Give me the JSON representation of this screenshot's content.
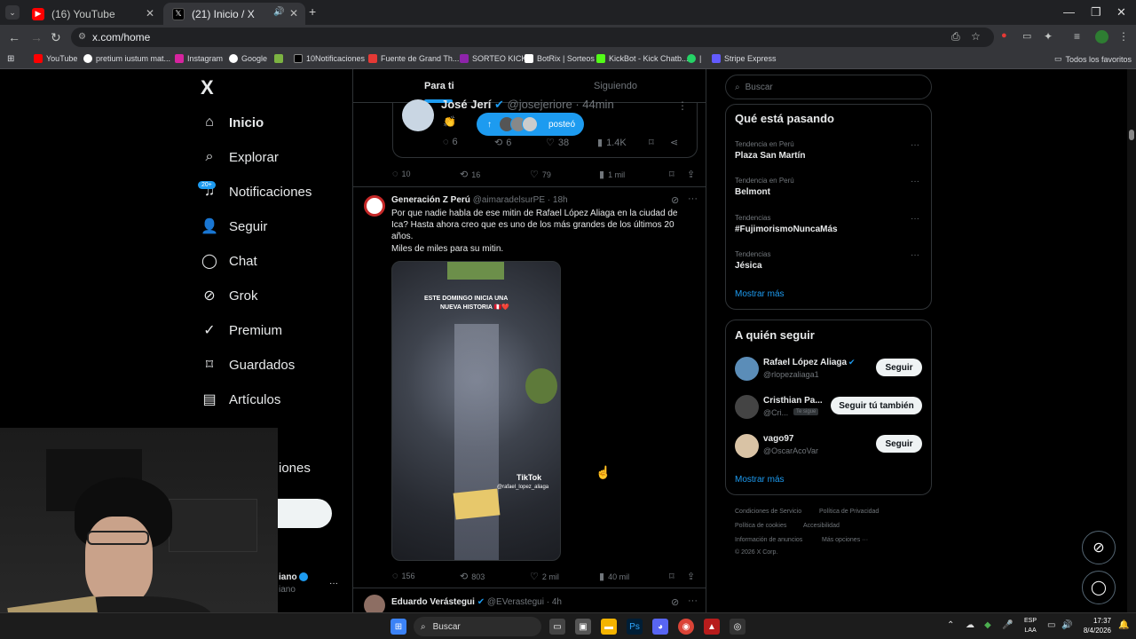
{
  "browser": {
    "tabs": [
      {
        "title": "(16) YouTube",
        "active": false
      },
      {
        "title": "(21) Inicio / X",
        "active": true
      }
    ],
    "new_tab": "+",
    "url": "x.com/home",
    "bookmarks": [
      "YouTube",
      "pretium iustum mat...",
      "Instagram",
      "Google",
      "10Notificaciones",
      "Fuente de Grand Th...",
      "SORTEO KICK",
      "BotRix | Sorteos",
      "KickBot - Kick Chatb...",
      "|",
      "Stripe Express"
    ],
    "all_bookmarks": "Todos los favoritos"
  },
  "x": {
    "logo": "X",
    "nav": [
      {
        "label": "Inicio",
        "icon": "home-icon"
      },
      {
        "label": "Explorar",
        "icon": "search-icon"
      },
      {
        "label": "Notificaciones",
        "icon": "bell-icon",
        "badge": "20+"
      },
      {
        "label": "Seguir",
        "icon": "person-add-icon"
      },
      {
        "label": "Chat",
        "icon": "chat-icon"
      },
      {
        "label": "Grok",
        "icon": "grok-icon"
      },
      {
        "label": "Premium",
        "icon": "premium-icon"
      },
      {
        "label": "Guardados",
        "icon": "bookmark-icon"
      },
      {
        "label": "Artículos",
        "icon": "articles-icon"
      }
    ],
    "nav_partial": "iones",
    "account_partial_name": "iano",
    "account_partial_handle": "iano",
    "account_more": "···",
    "feed_tabs": {
      "for_you": "Para ti",
      "following": "Siguiendo"
    },
    "quoted": {
      "name": "José Jerí",
      "handle": "@josejeriore",
      "time": "· 44min",
      "text": "👏",
      "replies": "6",
      "reposts": "6",
      "likes": "38",
      "views": "1.4K"
    },
    "new_posts_pill": "posteó",
    "post1_actions": {
      "replies": "10",
      "reposts": "16",
      "likes": "79",
      "views": "1 mil"
    },
    "post2": {
      "name": "Generación Z Perú",
      "handle": "@aimaradelsurPE",
      "time": "· 18h",
      "text_line1": "Por que nadie habla de ese mitin de Rafael López Aliaga en la ciudad de",
      "text_line2": "Ica? Hasta ahora creo que es uno de los más grandes de los últimos 20",
      "text_line3": "años.",
      "text_line4": "Miles de miles para su mitin.",
      "video_caption_1": "ESTE DOMINGO INICIA UNA",
      "video_caption_2": "NUEVA HISTORIA 🇵🇪❤️",
      "tiktok": "TikTok",
      "tiktok_handle": "@rafael_lopez_aliaga",
      "replies": "156",
      "reposts": "803",
      "likes": "2 mil",
      "views": "40 mil"
    },
    "post3": {
      "name": "Eduardo Verástegui",
      "handle": "@EVerastegui",
      "time": "· 4h"
    },
    "search_placeholder": "Buscar",
    "trends_title": "Qué está pasando",
    "trends": [
      {
        "meta": "Tendencia en Perú",
        "name": "Plaza San Martín"
      },
      {
        "meta": "Tendencia en Perú",
        "name": "Belmont"
      },
      {
        "meta": "Tendencias",
        "name": "#FujimorismoNuncaMás"
      },
      {
        "meta": "Tendencias",
        "name": "Jésica"
      }
    ],
    "trends_more": "Mostrar más",
    "who_to_follow_title": "A quién seguir",
    "who_to_follow": [
      {
        "name": "Rafael López Aliaga",
        "handle": "@rlopezaliaga1",
        "button": "Seguir",
        "follows_you": ""
      },
      {
        "name": "Cristhian Pa...",
        "handle": "@Cri...",
        "button": "Seguir tú también",
        "follows_you": "Te sigue"
      },
      {
        "name": "vago97",
        "handle": "@OscarAcoVar",
        "button": "Seguir",
        "follows_you": ""
      }
    ],
    "who_more": "Mostrar más",
    "footer": {
      "terms": "Condiciones de Servicio",
      "privacy": "Política de Privacidad",
      "cookies": "Política de cookies",
      "accessibility": "Accesibilidad",
      "ads": "Información de anuncios",
      "more": "Más opciones ···",
      "copyright": "© 2026 X Corp."
    }
  },
  "taskbar": {
    "search": "Buscar",
    "lang_1": "ESP",
    "lang_2": "LAA",
    "time": "17:37",
    "date": "8/4/2026"
  },
  "colors": {
    "accent": "#1d9bf0",
    "bg": "#000000",
    "border": "#2f3336",
    "muted": "#71767b"
  }
}
